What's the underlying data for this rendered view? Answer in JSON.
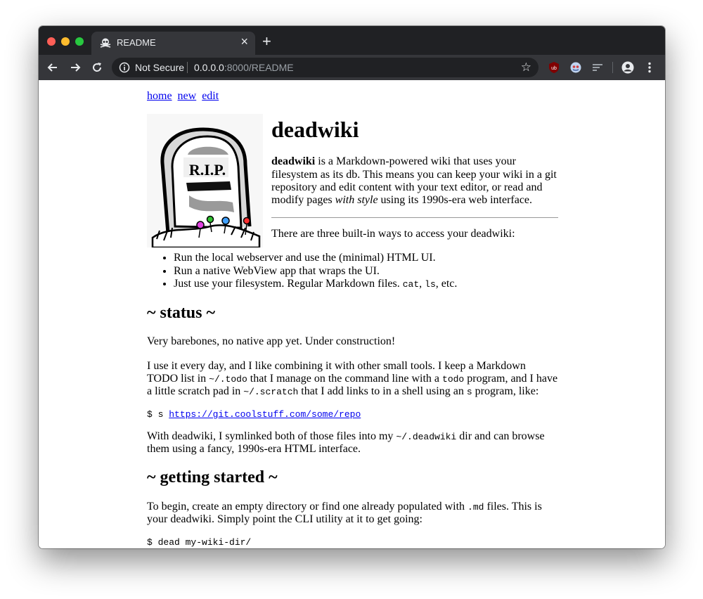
{
  "browser": {
    "tab_title": "README",
    "tab_close": "×",
    "new_tab": "+",
    "security_label": "Not Secure",
    "url_host": "0.0.0.0",
    "url_rest": ":8000/README",
    "bookmark_star": "☆"
  },
  "nav": {
    "home": "home",
    "new": "new",
    "edit": "edit"
  },
  "logo_text": "R.I.P.",
  "intro": {
    "title": "deadwiki",
    "lead_bold": "deadwiki",
    "lead_text_1": " is a Markdown-powered wiki that uses your filesystem as its db. This means you can keep your wiki in a git repository and edit content with your text editor, or read and modify pages ",
    "lead_em": "with style",
    "lead_text_2": " using its 1990s-era web interface.",
    "ways_text": "There are three built-in ways to access your deadwiki:"
  },
  "ways": {
    "item1": "Run the local webserver and use the (minimal) HTML UI.",
    "item2": "Run a native WebView app that wraps the UI.",
    "item3_text": "Just use your filesystem. Regular Markdown files. ",
    "item3_code1": "cat",
    "item3_sep": ", ",
    "item3_code2": "ls",
    "item3_end": ", etc."
  },
  "status": {
    "heading": "~ status ~",
    "p1": "Very barebones, no native app yet. Under construction!",
    "p2_a": "I use it every day, and I like combining it with other small tools. I keep a Markdown TODO list in ",
    "p2_code1": "~/.todo",
    "p2_b": " that I manage on the command line with a ",
    "p2_code2": "todo",
    "p2_c": " program, and I have a little scratch pad in ",
    "p2_code3": "~/.scratch",
    "p2_d": " that I add links to in a shell using an ",
    "p2_code4": "s",
    "p2_e": " program, like:",
    "cmd_prefix": "$ s ",
    "cmd_link": "https://git.coolstuff.com/some/repo",
    "p3_a": "With deadwiki, I symlinked both of those files into my ",
    "p3_code": "~/.deadwiki",
    "p3_b": " dir and can browse them using a fancy, 1990s-era HTML interface."
  },
  "getting_started": {
    "heading": "~ getting started ~",
    "p1_a": "To begin, create an empty directory or find one already populated with ",
    "p1_code": ".md",
    "p1_b": " files. This is your deadwiki. Simply point the CLI utility at it to get going:",
    "cmd1": "$ dead my-wiki-dir/"
  },
  "colors": {
    "tabbar": "#202124",
    "toolbar": "#35363a",
    "link": "#0000ee",
    "close_light": "#ff5f57",
    "min_light": "#febc2e",
    "max_light": "#28c840"
  }
}
